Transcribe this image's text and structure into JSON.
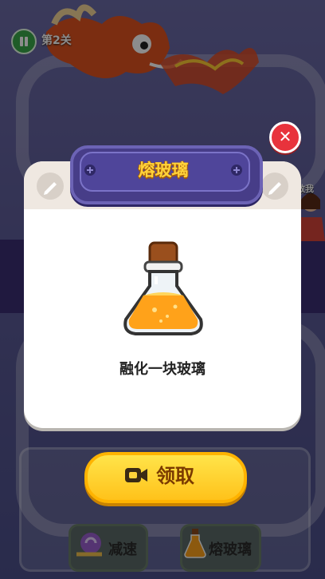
{
  "hud": {
    "level_label": "第2关",
    "save_me_label": "救我"
  },
  "dialog": {
    "title": "熔玻璃",
    "item_icon": "potion-flask-icon",
    "description": "融化一块玻璃",
    "close_icon": "close-icon"
  },
  "claim_button": {
    "label": "领取",
    "icon": "video-camera-icon"
  },
  "powerups": [
    {
      "label": "减速",
      "icon": "snail-icon"
    },
    {
      "label": "熔玻璃",
      "icon": "potion-flask-icon"
    }
  ],
  "colors": {
    "title_text": "#ffd23a",
    "title_plate": "#473d88",
    "close_button": "#e8333c",
    "claim_button": "#ffc21a",
    "potion_liquid": "#ffa21a"
  }
}
